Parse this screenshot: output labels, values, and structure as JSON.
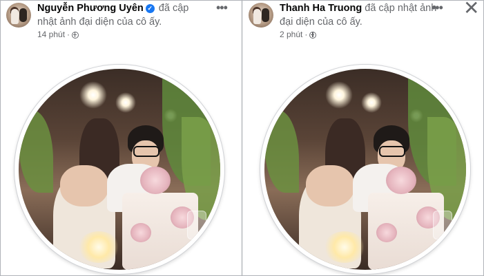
{
  "posts": [
    {
      "author": "Nguyễn Phương Uyên",
      "verified_mark": "✓",
      "action_text": "đã cập nhật ảnh đại diện của cô ấy.",
      "time": "14 phút",
      "separator": "·",
      "privacy_icon": "globe-icon",
      "more_label": "•••"
    },
    {
      "author": "Thanh Ha Truong",
      "action_text": "đã cập nhật ảnh đại diện của cô ấy.",
      "time": "2 phút",
      "separator": "·",
      "privacy_icon": "globe-icon",
      "more_label": "•••",
      "close_label": "✕"
    }
  ],
  "colors": {
    "name_text": "#050505",
    "secondary_text": "#65676b",
    "verified_badge": "#1877f2",
    "background": "#ffffff"
  }
}
